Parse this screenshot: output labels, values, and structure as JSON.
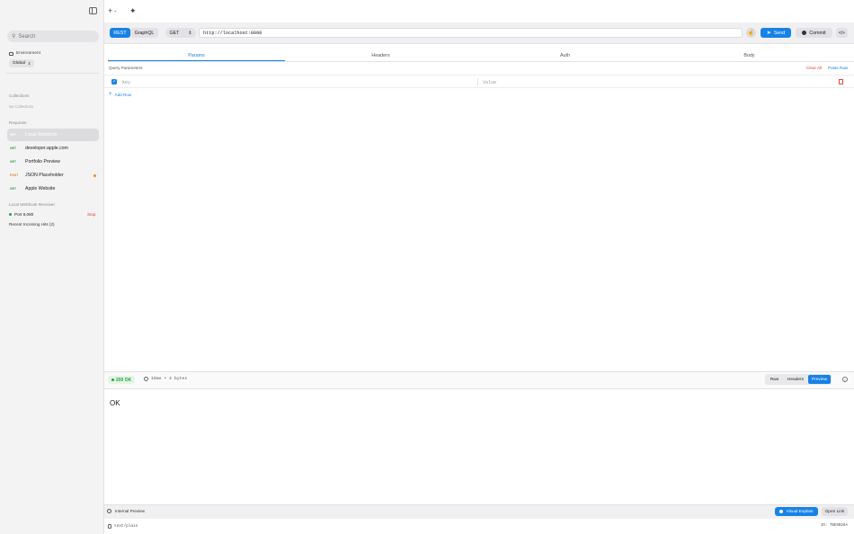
{
  "toolbar": {
    "add_label": "+",
    "add_chevron": "⌄",
    "ai_icon": "sparkle-icon"
  },
  "sidebar": {
    "search_placeholder": "Search",
    "environment_label": "Environment",
    "environment_value": "Global",
    "collections_header": "Collections",
    "collections_empty": "No Collections",
    "requests_header": "Requests",
    "requests": [
      {
        "method": "GET",
        "name": "Local Webhook",
        "active": true
      },
      {
        "method": "GET",
        "name": "developer.apple.com",
        "active": false
      },
      {
        "method": "GET",
        "name": "Portfolio Preview",
        "active": false
      },
      {
        "method": "POST",
        "name": "JSON Placeholder",
        "active": false,
        "modified": true
      },
      {
        "method": "GET",
        "name": "Apple Website",
        "active": false
      }
    ],
    "webhook_header": "Local Webhook Receiver",
    "port_label": "Port 8,080",
    "stop_label": "Stop",
    "hits_label": "Recent Incoming Hits (2)"
  },
  "request": {
    "mode_rest": "REST",
    "mode_graphql": "GraphQL",
    "method": "GET",
    "url": "http://localhost:8080",
    "send_label": "Send",
    "commit_label": "Commit",
    "code_label": "</>"
  },
  "tabs": [
    "Params",
    "Headers",
    "Auth",
    "Body"
  ],
  "params": {
    "header": "Query Parameters",
    "clear_all": "Clear All",
    "paste_raw": "Paste Raw",
    "key_placeholder": "Key",
    "value_placeholder": "Value",
    "add_row": "Add Row"
  },
  "response": {
    "status": "200 OK",
    "meta": "16ms • 2 bytes",
    "views": [
      "Raw",
      "Headers",
      "Preview"
    ],
    "active_view": "Preview",
    "body": "OK",
    "internal_preview": "Internal Preview",
    "visual_explain": "Visual Explain",
    "open_link": "Open Link",
    "content_type": "text/plain",
    "request_id": "ID: 7BE9B26A"
  },
  "colors": {
    "accent": "#1782e6",
    "get": "#2e9e45",
    "post": "#e0851c",
    "danger": "#e0443a"
  }
}
